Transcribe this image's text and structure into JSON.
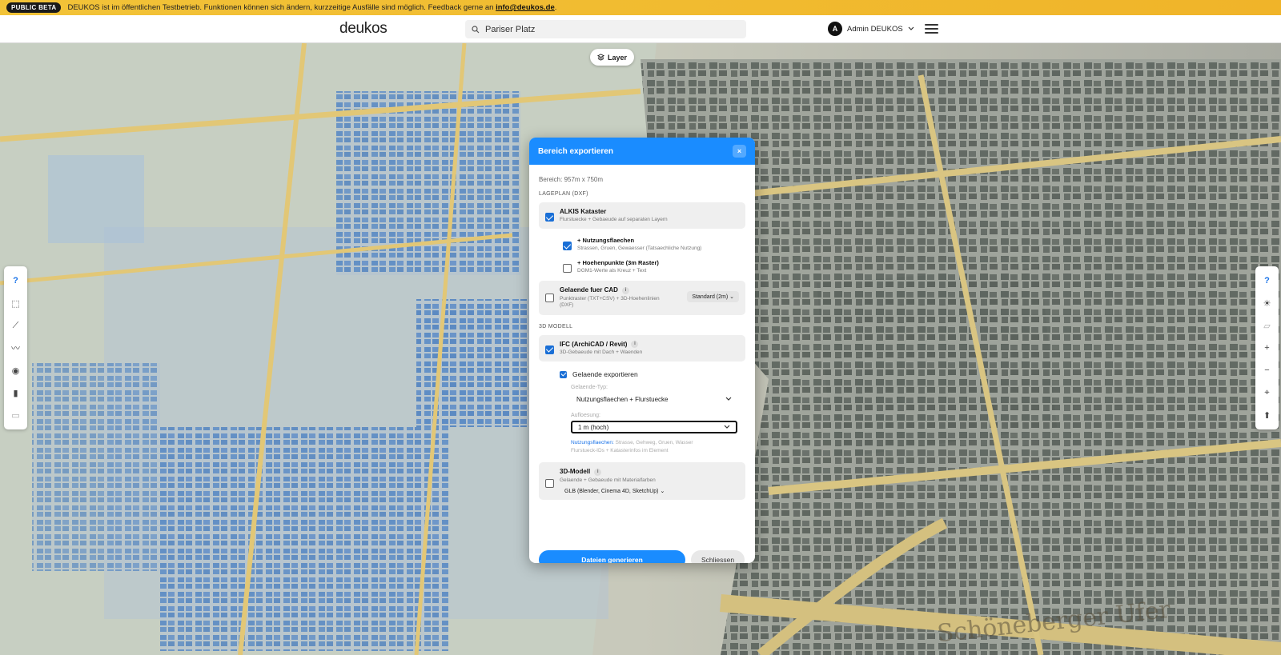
{
  "banner": {
    "badge": "PUBLIC BETA",
    "text": "DEUKOS ist im öffentlichen Testbetrieb. Funktionen können sich ändern, kurzzeitige Ausfälle sind möglich. Feedback gerne an ",
    "email": "info@deukos.de",
    "suffix": "."
  },
  "header": {
    "logo": "deukos",
    "search_value": "Pariser Platz",
    "user_initial": "A",
    "user_name": "Admin DEUKOS"
  },
  "map": {
    "layer_button": "Layer",
    "street_label": "Schöneberger Ufer",
    "left_toolbar": [
      {
        "name": "help",
        "icon": "help-icon",
        "glyph": "?"
      },
      {
        "name": "select-area",
        "icon": "select-area-icon",
        "glyph": "⬚"
      },
      {
        "name": "measure-line",
        "icon": "measure-line-icon",
        "glyph": "⟋"
      },
      {
        "name": "profile",
        "icon": "profile-icon",
        "glyph": "〰"
      },
      {
        "name": "view",
        "icon": "eye-icon",
        "glyph": "◉"
      },
      {
        "name": "stats",
        "icon": "bar-chart-icon",
        "glyph": "▮"
      },
      {
        "name": "export",
        "icon": "export-icon",
        "glyph": "▭"
      }
    ],
    "right_toolbar": [
      {
        "name": "help",
        "icon": "help-icon",
        "glyph": "?"
      },
      {
        "name": "sun",
        "icon": "sun-icon",
        "glyph": "☀"
      },
      {
        "name": "layers-3d",
        "icon": "3d-layers-icon",
        "glyph": "▱"
      },
      {
        "name": "zoom-in",
        "icon": "plus-icon",
        "glyph": "+"
      },
      {
        "name": "zoom-out",
        "icon": "minus-icon",
        "glyph": "−"
      },
      {
        "name": "locate",
        "icon": "crosshair-icon",
        "glyph": "⌖"
      },
      {
        "name": "compass",
        "icon": "compass-icon",
        "glyph": "⬆"
      }
    ]
  },
  "modal": {
    "title": "Bereich exportieren",
    "close": "×",
    "range": "Bereich: 957m x 750m",
    "section_lageplan": "LAGEPLAN (DXF)",
    "alkis": {
      "title": "ALKIS Kataster",
      "desc": "Flurstuecke + Gebaeude auf separaten Layern",
      "checked": true
    },
    "nutzung": {
      "title": "+ Nutzungsflaechen",
      "desc": "Strassen, Gruen, Gewaesser (Tatsaechliche Nutzung)",
      "checked": true
    },
    "hoehen": {
      "title": "+ Hoehenpunkte (3m Raster)",
      "desc": "DGM1-Werte als Kreuz + Text",
      "checked": false
    },
    "gelaende_cad": {
      "title": "Gelaende fuer CAD",
      "desc": "Punktraster (TXT+CSV) + 3D-Hoehenlinien (DXF)",
      "select": "Standard (2m)",
      "checked": false
    },
    "section_3d": "3D MODELL",
    "ifc": {
      "title": "IFC (ArchiCAD / Revit)",
      "desc": "3D-Gebaeude mit Dach + Waenden",
      "checked": true
    },
    "gelaende_export": {
      "label": "Gelaende exportieren",
      "checked": true
    },
    "gelaende_typ_label": "Gelaende-Typ:",
    "gelaende_typ_value": "Nutzungsflaechen + Flurstuecke",
    "aufloesung_label": "Aufloesung:",
    "aufloesung_value": "1 m (hoch)",
    "hint_link": "Nutzungsflaechen:",
    "hint_text": " Strasse, Gehweg, Gruen, Wasser",
    "hint_line2": "Flurstueck-IDs + Katasterinfos im Element",
    "modell3d": {
      "title": "3D-Modell",
      "desc": "Gelaende + Gebaeude mit Materialfarben",
      "format": "GLB (Blender, Cinema 4D, SketchUp)",
      "checked": false
    },
    "primary_button": "Dateien generieren",
    "secondary_button": "Schliessen"
  },
  "colors": {
    "accent": "#1a8cff",
    "banner": "#f2c338"
  }
}
